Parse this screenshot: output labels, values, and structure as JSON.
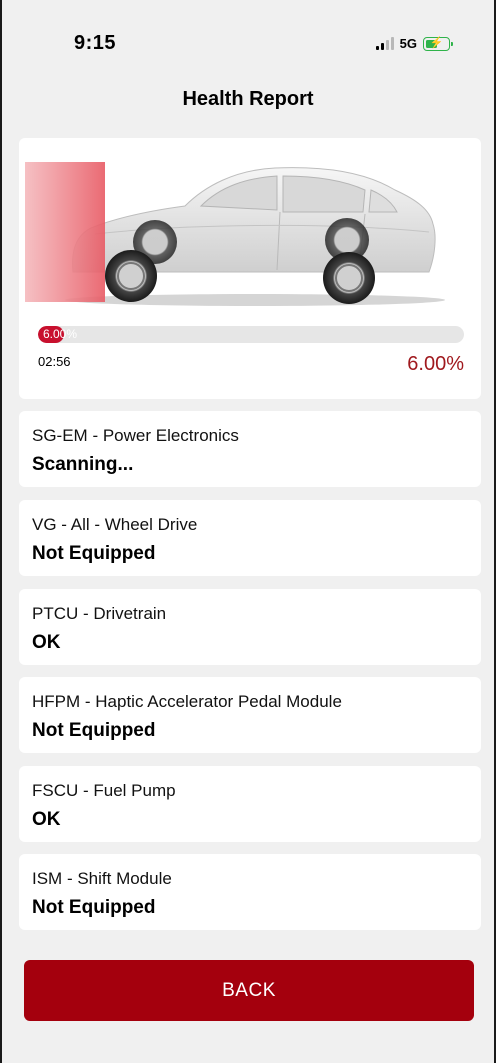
{
  "status_bar": {
    "time": "9:15",
    "network": "5G",
    "battery_level": 0.45,
    "battery_color": "#2fb34a"
  },
  "header": {
    "title": "Health Report"
  },
  "scan": {
    "progress": 0.06,
    "progress_label": "6.00%",
    "elapsed": "02:56",
    "percent": "6.00%",
    "accent_color": "#a0191e"
  },
  "modules": [
    {
      "name": "SG-EM - Power Electronics",
      "status": "Scanning..."
    },
    {
      "name": "VG - All - Wheel Drive",
      "status": "Not Equipped"
    },
    {
      "name": "PTCU - Drivetrain",
      "status": "OK"
    },
    {
      "name": "HFPM - Haptic Accelerator Pedal Module",
      "status": "Not Equipped"
    },
    {
      "name": "FSCU - Fuel Pump",
      "status": "OK"
    },
    {
      "name": "ISM - Shift Module",
      "status": "Not Equipped"
    }
  ],
  "footer": {
    "back_label": "BACK",
    "button_color": "#a4000d"
  }
}
